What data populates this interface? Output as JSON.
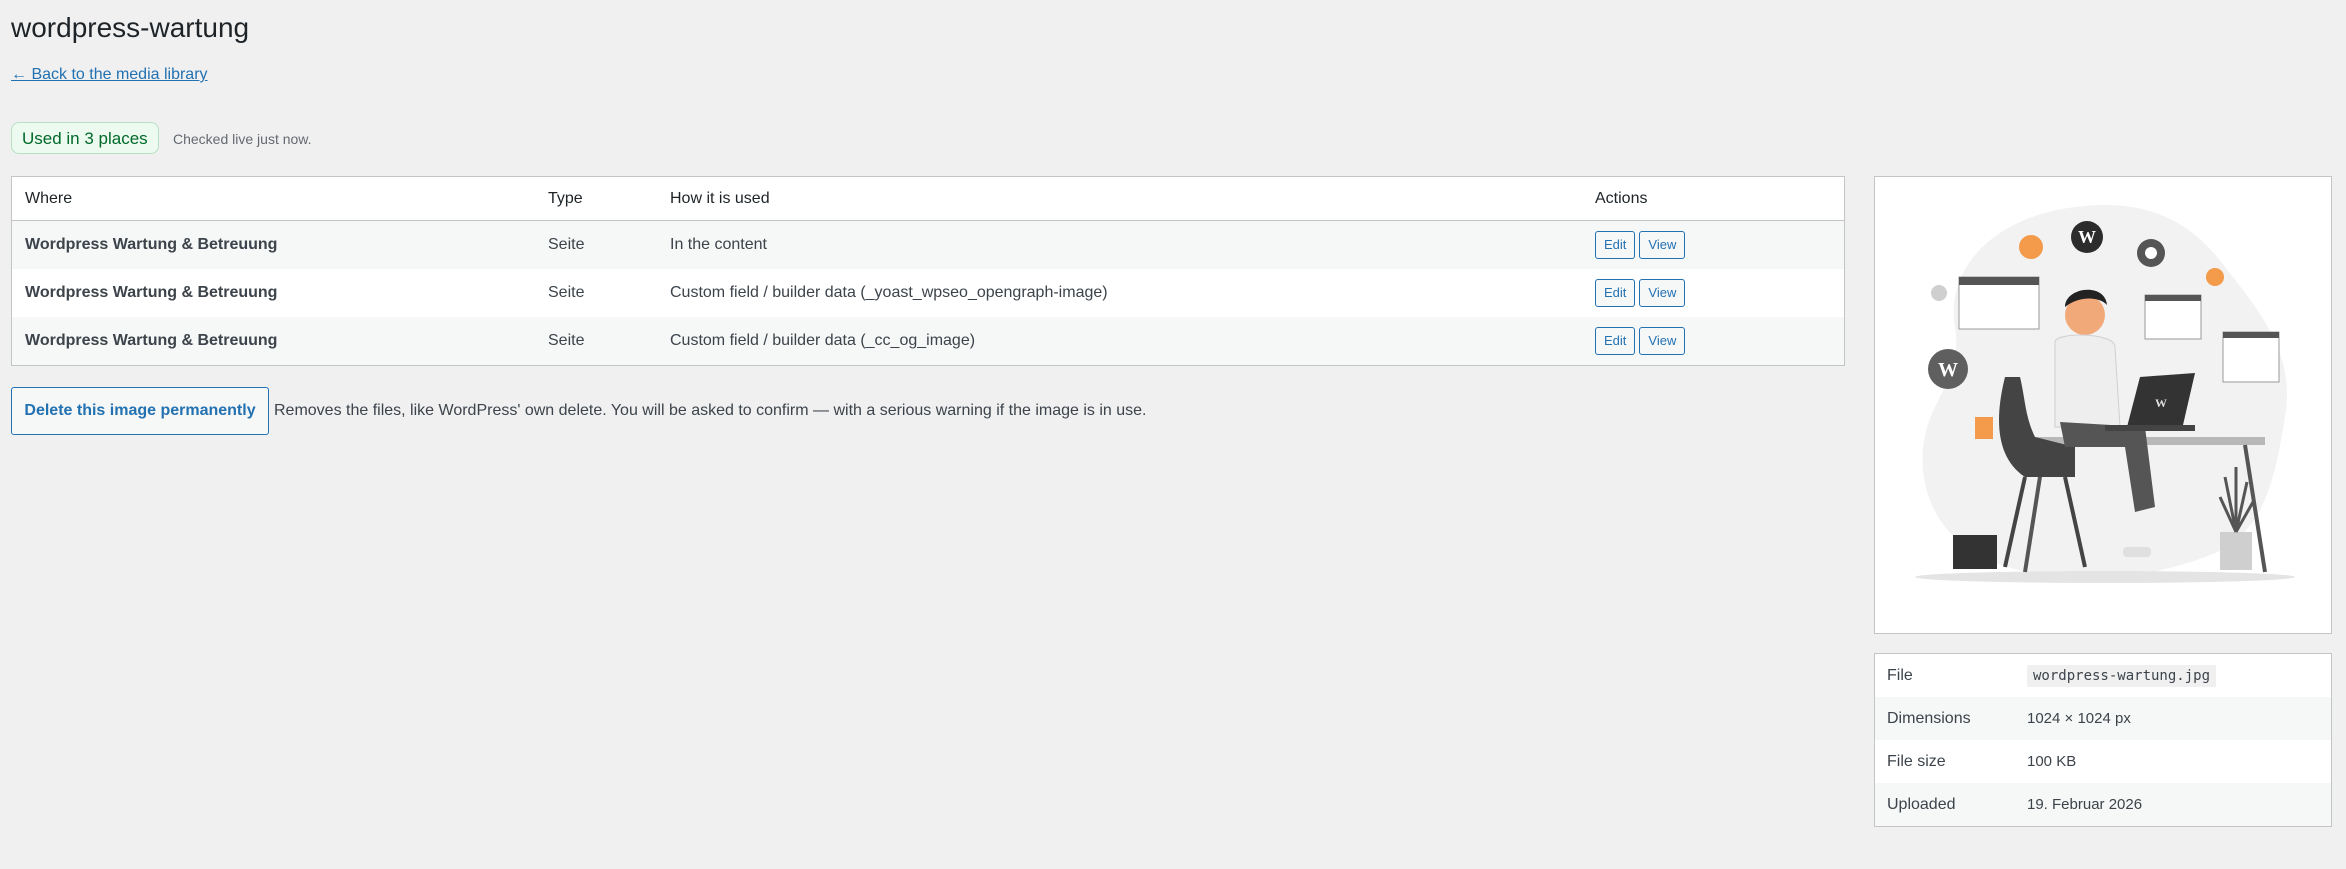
{
  "page": {
    "title": "wordpress-wartung",
    "back_link": "← Back to the media library"
  },
  "usage": {
    "badge": "Used in 3 places",
    "checked": "Checked live just now.",
    "columns": {
      "where": "Where",
      "type": "Type",
      "how": "How it is used",
      "actions": "Actions"
    },
    "rows": [
      {
        "where": "Wordpress Wartung & Betreuung",
        "type": "Seite",
        "how": "In the content",
        "edit": "Edit",
        "view": "View"
      },
      {
        "where": "Wordpress Wartung & Betreuung",
        "type": "Seite",
        "how": "Custom field / builder data (_yoast_wpseo_opengraph-image)",
        "edit": "Edit",
        "view": "View"
      },
      {
        "where": "Wordpress Wartung & Betreuung",
        "type": "Seite",
        "how": "Custom field / builder data (_cc_og_image)",
        "edit": "Edit",
        "view": "View"
      }
    ]
  },
  "delete": {
    "button": "Delete this image permanently",
    "help": "Removes the files, like WordPress' own delete. You will be asked to confirm — with a serious warning if the image is in use."
  },
  "meta": {
    "file_label": "File",
    "file_value": "wordpress-wartung.jpg",
    "dimensions_label": "Dimensions",
    "dimensions_value": "1024 × 1024 px",
    "size_label": "File size",
    "size_value": "100 KB",
    "uploaded_label": "Uploaded",
    "uploaded_value": "19. Februar 2026"
  },
  "colors": {
    "accent": "#2271b1",
    "badge_text": "#00692a",
    "badge_bg": "#edfaef",
    "page_bg": "#f0f0f1"
  }
}
